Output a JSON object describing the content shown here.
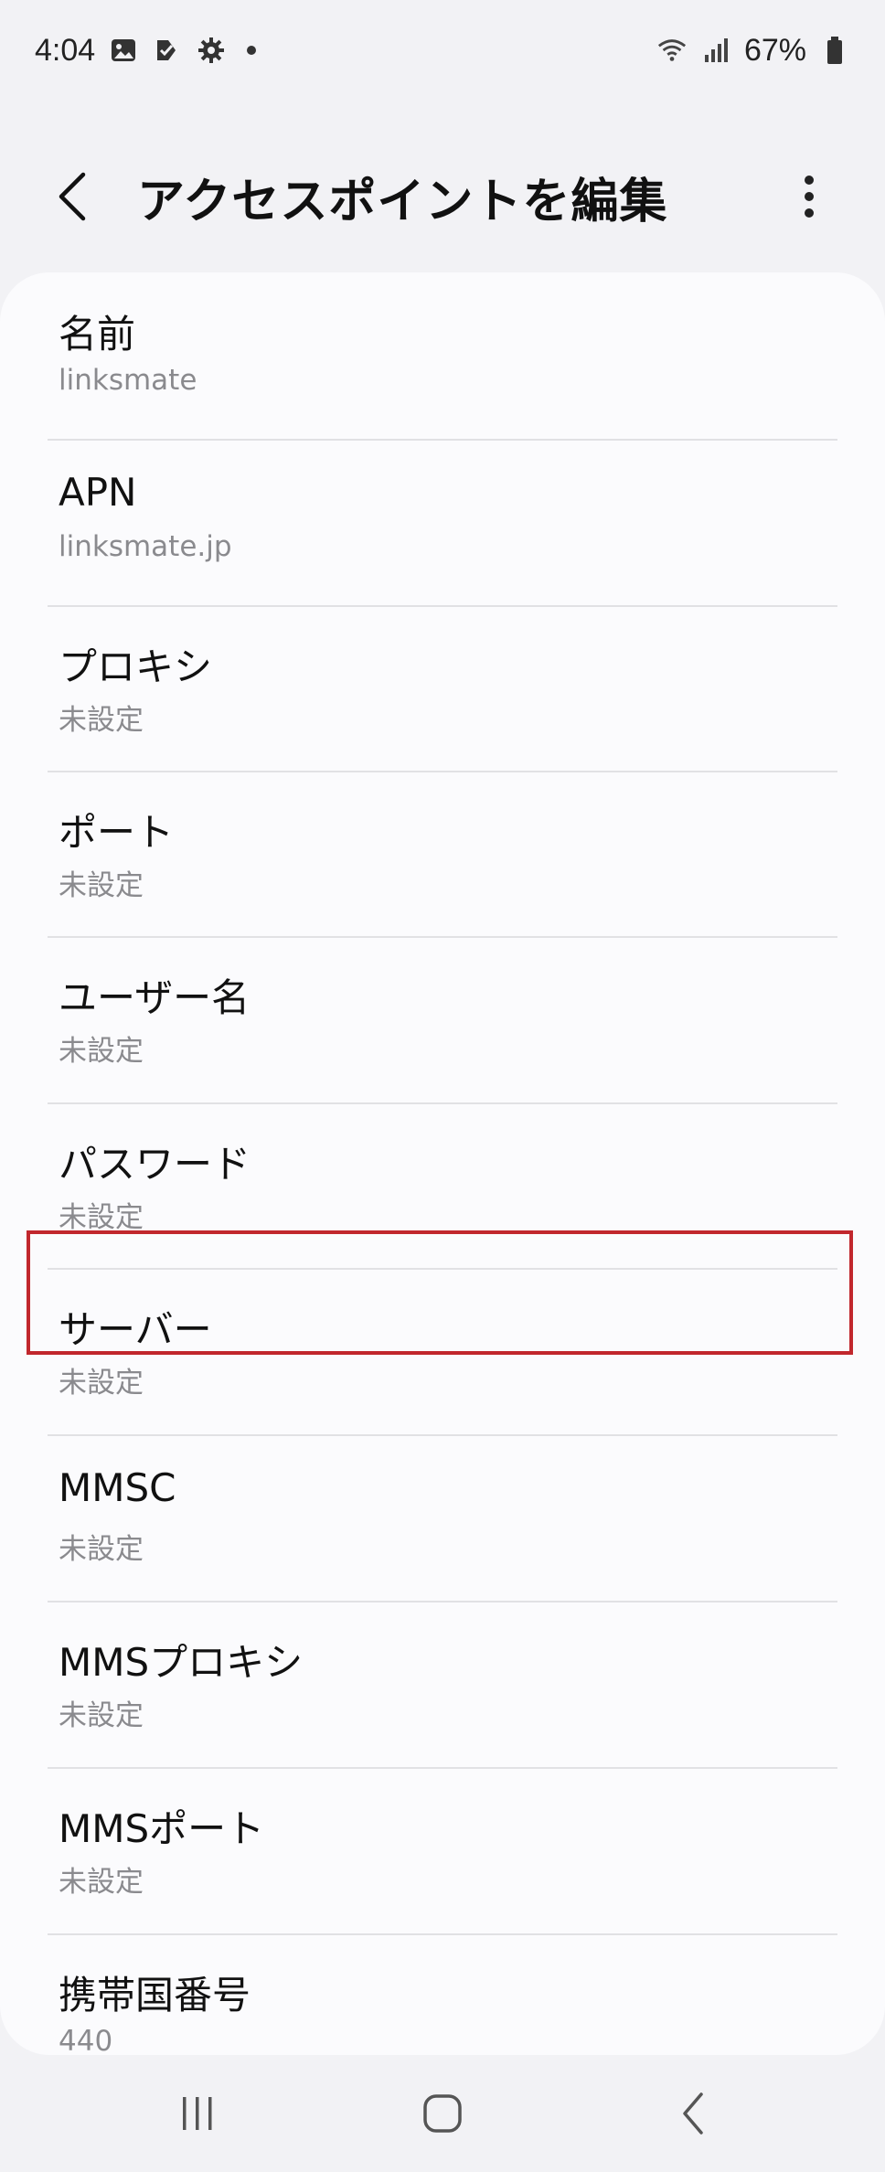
{
  "status_bar": {
    "time": "4:04",
    "battery": "67%",
    "icons_left": [
      "gallery-icon",
      "check-flag-icon",
      "gear-icon",
      "dot-icon"
    ],
    "icons_right": [
      "wifi-icon",
      "signal-icon",
      "battery-icon"
    ]
  },
  "header": {
    "title": "アクセスポイントを編集",
    "back_icon": "chevron-left-icon",
    "more_icon": "more-vertical-icon"
  },
  "settings": [
    {
      "label": "名前",
      "value": "linksmate"
    },
    {
      "label": "APN",
      "value": "linksmate.jp"
    },
    {
      "label": "プロキシ",
      "value": "未設定"
    },
    {
      "label": "ポート",
      "value": "未設定"
    },
    {
      "label": "ユーザー名",
      "value": "未設定"
    },
    {
      "label": "パスワード",
      "value": "未設定"
    },
    {
      "label": "サーバー",
      "value": "未設定"
    },
    {
      "label": "MMSC",
      "value": "未設定"
    },
    {
      "label": "MMSプロキシ",
      "value": "未設定"
    },
    {
      "label": "MMSポート",
      "value": "未設定"
    },
    {
      "label": "携帯国番号",
      "value": "440"
    }
  ],
  "highlighted_item": "ユーザー名",
  "colors": {
    "highlight": "#c1272d",
    "background": "#f2f2f5",
    "card": "#fbfbfd"
  },
  "nav_bar": {
    "icons": [
      "recent-apps-icon",
      "home-icon",
      "back-icon"
    ]
  }
}
